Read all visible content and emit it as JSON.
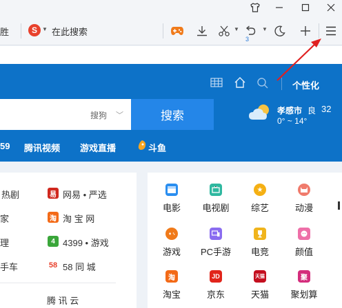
{
  "window": {
    "controls": [
      "shirt-icon",
      "minimize-icon",
      "maximize-icon",
      "close-icon"
    ]
  },
  "toolbar": {
    "address_fragment": "胜",
    "search_placeholder": "在此搜索",
    "engine_logo_char": "S",
    "undo_badge": "3",
    "icons": [
      "game-controller-icon",
      "download-icon",
      "scissors-icon",
      "undo-icon",
      "moon-icon",
      "plus-icon",
      "menu-icon"
    ]
  },
  "header": {
    "personalize_label": "个性化",
    "icons": [
      "grid-icon",
      "home-icon",
      "search-icon"
    ]
  },
  "search": {
    "engine_label": "搜狗",
    "button_label": "搜索"
  },
  "weather": {
    "city": "孝感市",
    "aqi": "良",
    "temp": "32",
    "range": "0° ~ 14°"
  },
  "hero_links": [
    "59",
    "腾讯视频",
    "游戏直播",
    "斗鱼"
  ],
  "left_card": {
    "col1": [
      "热剧",
      "家",
      "理",
      "手车"
    ],
    "col2": [
      "网易 • 严选",
      "淘 宝 网",
      "4399 • 游戏",
      "58 同 城",
      "腾 讯 云"
    ],
    "badge_labels": [
      "易",
      "淘",
      "4",
      "58"
    ]
  },
  "apps": {
    "row1": [
      "电影",
      "电视剧",
      "综艺",
      "动漫"
    ],
    "row2": [
      "游戏",
      "PC手游",
      "电竞",
      "颜值"
    ],
    "row3": [
      "淘宝",
      "京东",
      "天猫",
      "聚划算"
    ],
    "row3_badges": [
      "淘",
      "JD",
      "天猫",
      "聚"
    ]
  },
  "colors": {
    "hero_blue": "#0d72c8",
    "search_button": "#2486e8",
    "annotation_arrow": "#e02020"
  }
}
